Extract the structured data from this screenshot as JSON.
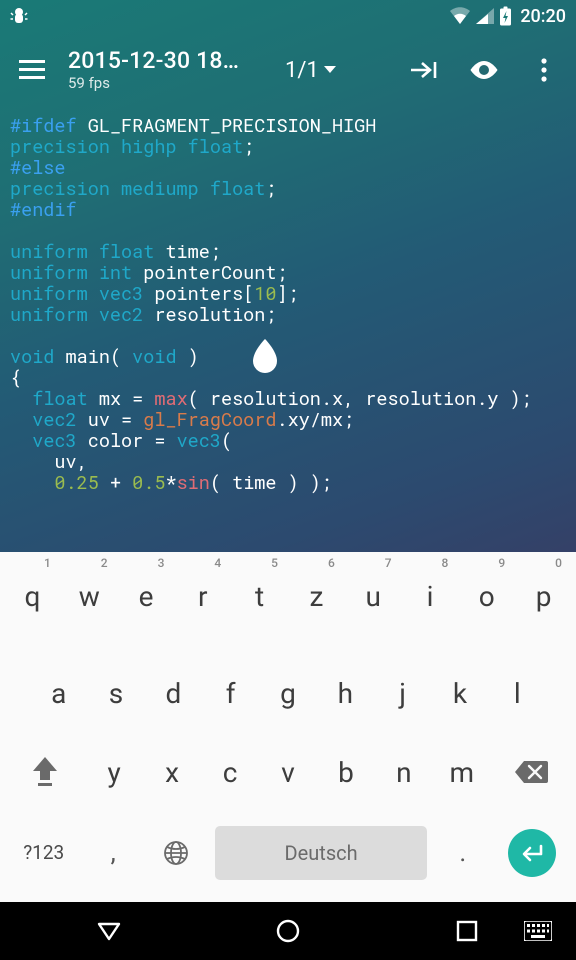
{
  "status": {
    "time": "20:20"
  },
  "appbar": {
    "title": "2015-12-30 18…",
    "subtitle": "59 fps",
    "counter": "1/1"
  },
  "code": {
    "lines": [
      [
        [
          "pre",
          "#ifdef"
        ],
        [
          "id",
          " "
        ],
        [
          "id",
          "GL_FRAGMENT_PRECISION_HIGH"
        ]
      ],
      [
        [
          "kw",
          "precision"
        ],
        [
          "id",
          " "
        ],
        [
          "kw",
          "highp"
        ],
        [
          "id",
          " "
        ],
        [
          "ty",
          "float"
        ],
        [
          "id",
          ";"
        ]
      ],
      [
        [
          "pre",
          "#else"
        ]
      ],
      [
        [
          "kw",
          "precision"
        ],
        [
          "id",
          " "
        ],
        [
          "kw",
          "mediump"
        ],
        [
          "id",
          " "
        ],
        [
          "ty",
          "float"
        ],
        [
          "id",
          ";"
        ]
      ],
      [
        [
          "pre",
          "#endif"
        ]
      ],
      [],
      [
        [
          "kw",
          "uniform"
        ],
        [
          "id",
          " "
        ],
        [
          "ty",
          "float"
        ],
        [
          "id",
          " time;"
        ]
      ],
      [
        [
          "kw",
          "uniform"
        ],
        [
          "id",
          " "
        ],
        [
          "ty",
          "int"
        ],
        [
          "id",
          " pointerCount;"
        ]
      ],
      [
        [
          "kw",
          "uniform"
        ],
        [
          "id",
          " "
        ],
        [
          "ty",
          "vec3"
        ],
        [
          "id",
          " pointers["
        ],
        [
          "num",
          "10"
        ],
        [
          "id",
          "];"
        ]
      ],
      [
        [
          "kw",
          "uniform"
        ],
        [
          "id",
          " "
        ],
        [
          "ty",
          "vec2"
        ],
        [
          "id",
          " resolution;"
        ]
      ],
      [],
      [
        [
          "ty",
          "void"
        ],
        [
          "id",
          " "
        ],
        [
          "id",
          "main"
        ],
        [
          "id",
          "( "
        ],
        [
          "ty",
          "void"
        ],
        [
          "id",
          " )"
        ]
      ],
      [
        [
          "id",
          "{"
        ]
      ],
      [
        [
          "id",
          "  "
        ],
        [
          "ty",
          "float"
        ],
        [
          "id",
          " mx = "
        ],
        [
          "fn",
          "max"
        ],
        [
          "id",
          "( resolution.x, resolution.y );"
        ]
      ],
      [
        [
          "id",
          "  "
        ],
        [
          "ty",
          "vec2"
        ],
        [
          "id",
          " uv = "
        ],
        [
          "fn2",
          "gl_FragCoord"
        ],
        [
          "id",
          ".xy/mx;"
        ]
      ],
      [
        [
          "id",
          "  "
        ],
        [
          "ty",
          "vec3"
        ],
        [
          "id",
          " color = "
        ],
        [
          "ty",
          "vec3"
        ],
        [
          "id",
          "("
        ]
      ],
      [
        [
          "id",
          "    uv,"
        ]
      ],
      [
        [
          "id",
          "    "
        ],
        [
          "num",
          "0.25"
        ],
        [
          "id",
          " + "
        ],
        [
          "num",
          "0.5"
        ],
        [
          "id",
          "*"
        ],
        [
          "fn",
          "sin"
        ],
        [
          "id",
          "( time ) );"
        ]
      ]
    ]
  },
  "keyboard": {
    "hints": [
      "1",
      "2",
      "3",
      "4",
      "5",
      "6",
      "7",
      "8",
      "9",
      "0"
    ],
    "row1": [
      "q",
      "w",
      "e",
      "r",
      "t",
      "z",
      "u",
      "i",
      "o",
      "p"
    ],
    "row2": [
      "a",
      "s",
      "d",
      "f",
      "g",
      "h",
      "j",
      "k",
      "l"
    ],
    "row3": [
      "y",
      "x",
      "c",
      "v",
      "b",
      "n",
      "m"
    ],
    "sym_label": "?123",
    "space_label": "Deutsch",
    "comma": ",",
    "period": "."
  }
}
